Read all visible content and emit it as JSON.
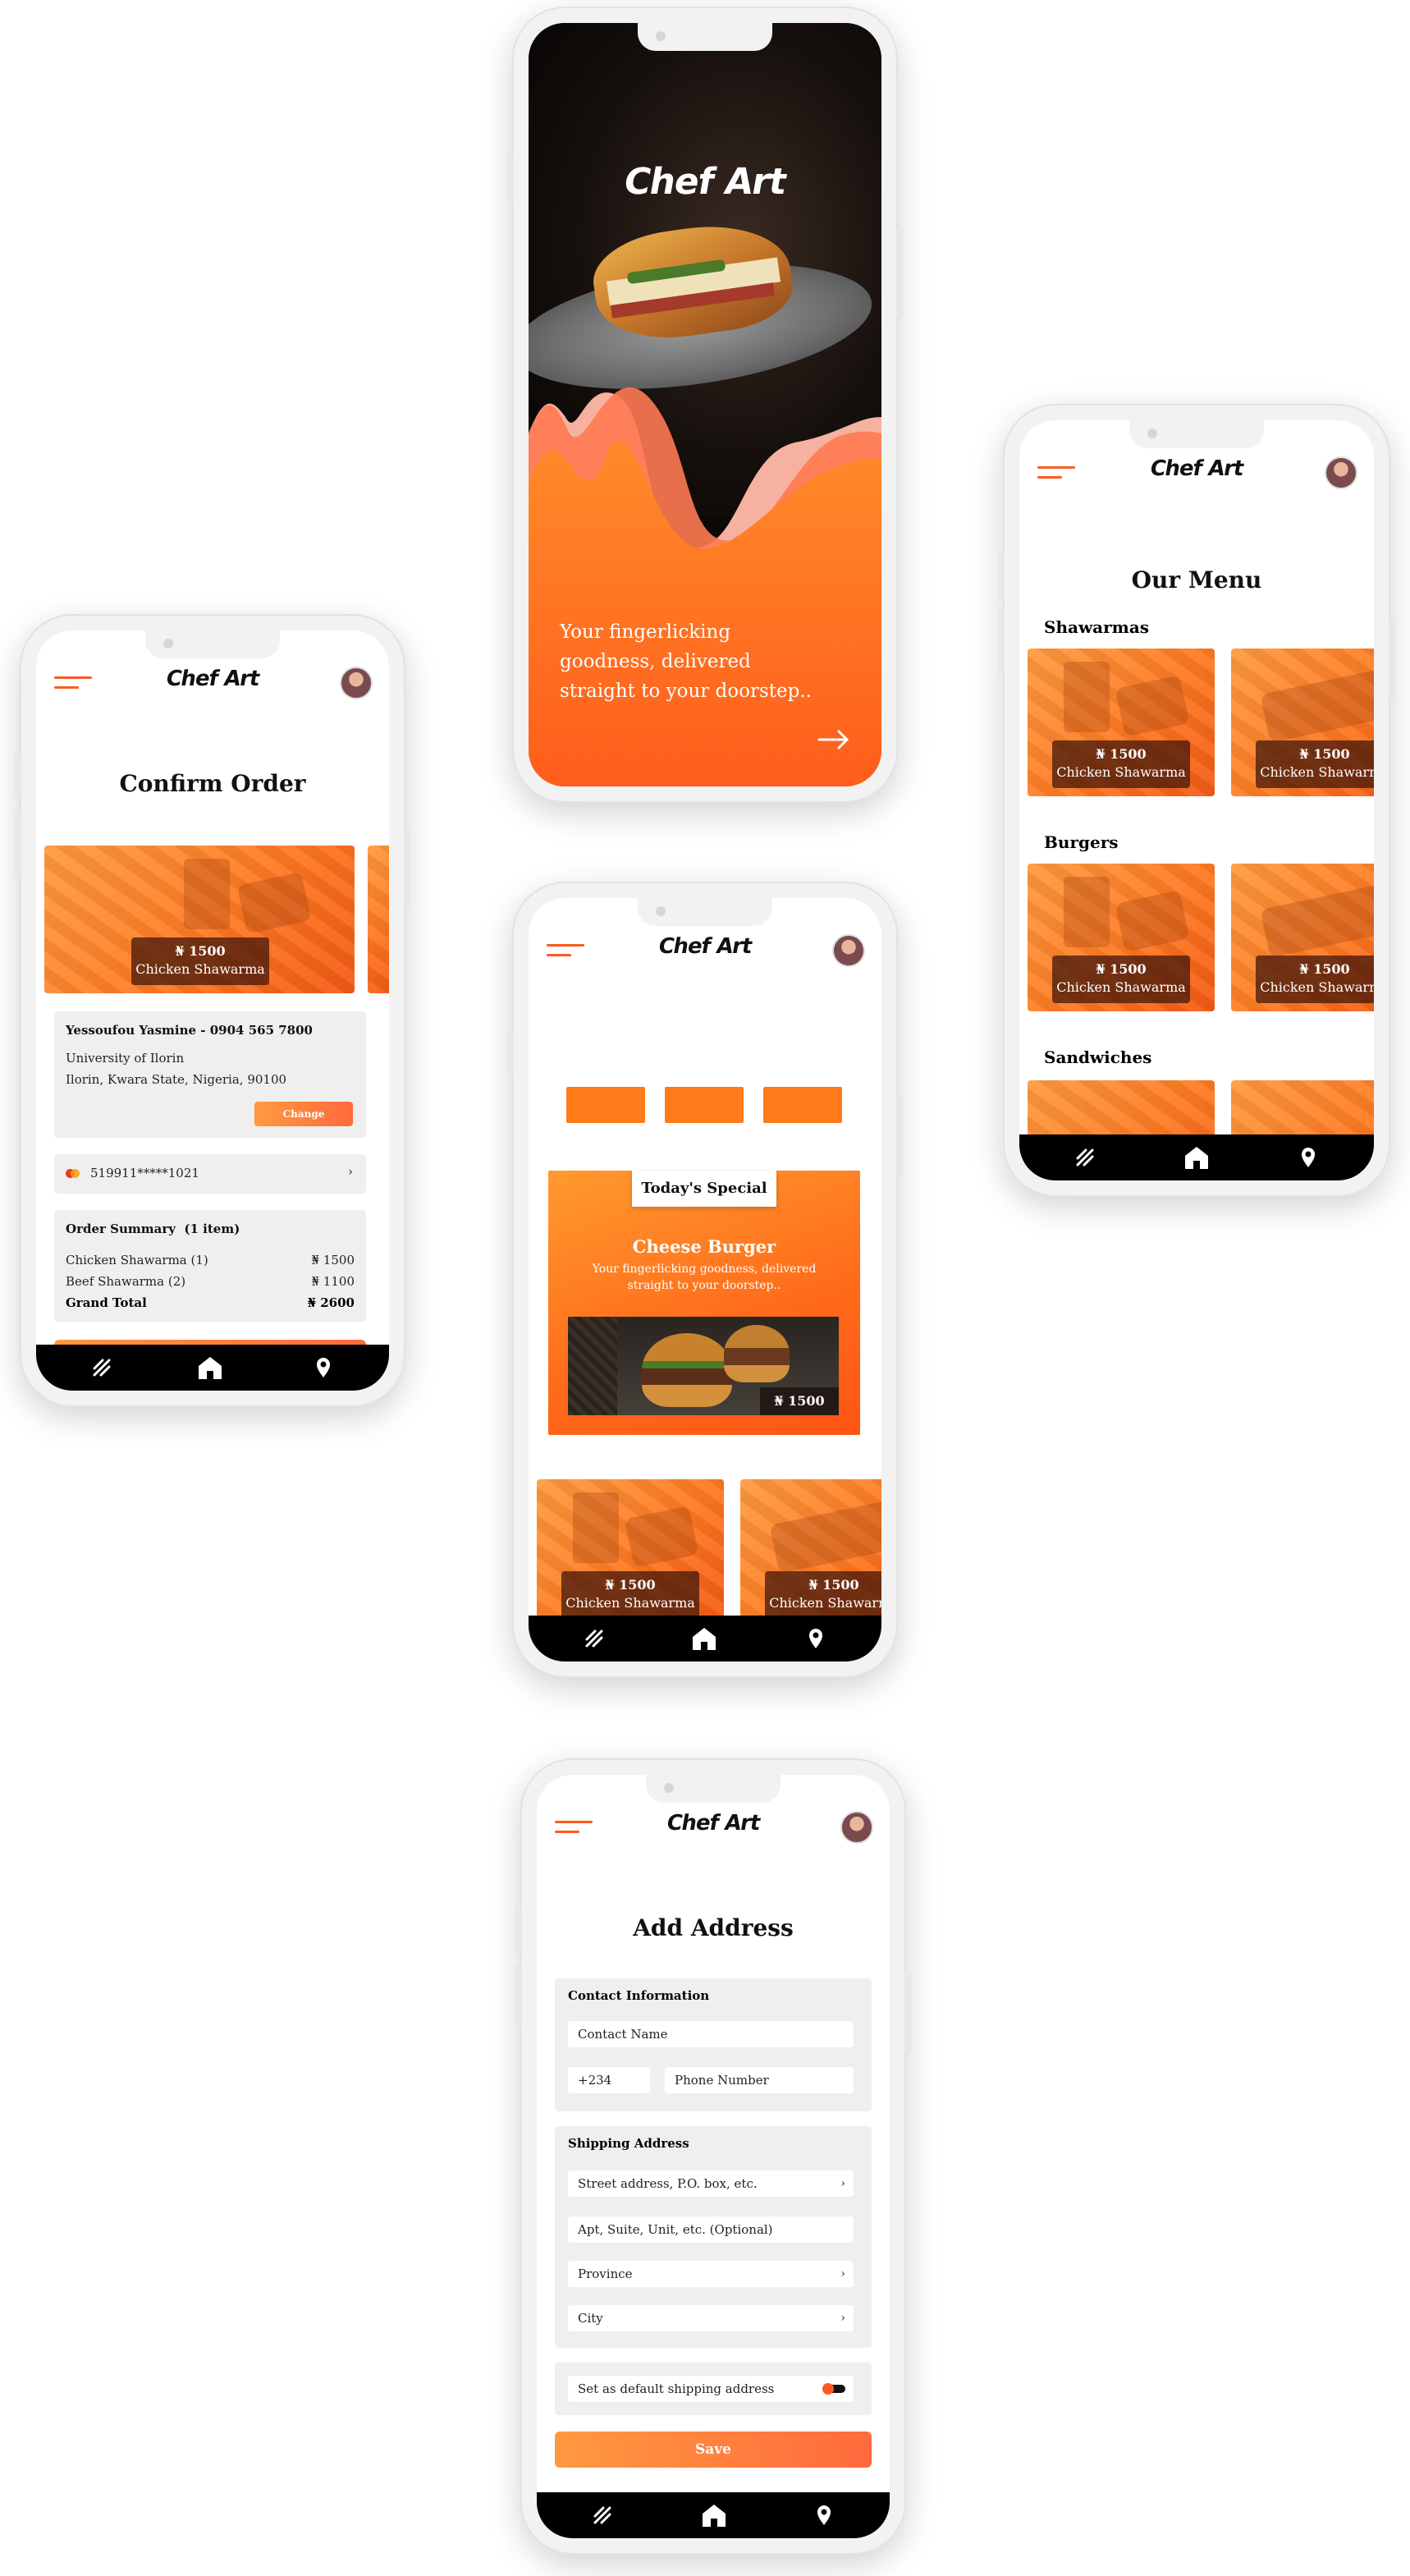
{
  "brand": {
    "logo": "Chef Art",
    "accent": "#ff5a1f"
  },
  "nav": {
    "icons": [
      "menu-stripes-icon",
      "home-icon",
      "location-pin-icon"
    ]
  },
  "splash": {
    "logo": "Chef Art",
    "tagline": "Your fingerlicking goodness, delivered straight to your doorstep..",
    "next_icon": "arrow-right-icon"
  },
  "confirm_order": {
    "title": "Confirm Order",
    "item": {
      "price": "₦ 1500",
      "name": "Chicken Shawarma"
    },
    "contact": {
      "name_phone": "Yessoufou Yasmine - 0904 565 7800",
      "address_line1": "University of Ilorin",
      "address_line2": "Ilorin, Kwara State, Nigeria, 90100",
      "change_label": "Change"
    },
    "card": {
      "number": "519911*****1021",
      "chevron": "›"
    },
    "summary": {
      "header": "Order Summary  (1 item)",
      "lines": [
        {
          "name": "Chicken Shawarma (1)",
          "price": "₦ 1500"
        },
        {
          "name": "Beef Shawarma (2)",
          "price": "₦ 1100"
        }
      ],
      "total_label": "Grand Total",
      "total_value": "₦ 2600"
    }
  },
  "home": {
    "special_tag": "Today's Special",
    "special_title": "Cheese Burger",
    "special_desc": "Your fingerlicking goodness, delivered straight to your doorstep..",
    "special_price": "₦ 1500",
    "cards": [
      {
        "price": "₦ 1500",
        "name": "Chicken Shawarma"
      },
      {
        "price": "₦ 1500",
        "name": "Chicken Shawarma"
      }
    ]
  },
  "menu": {
    "title": "Our Menu",
    "sections": [
      {
        "title": "Shawarmas",
        "cards": [
          {
            "price": "₦ 1500",
            "name": "Chicken Shawarma"
          },
          {
            "price": "₦ 1500",
            "name": "Chicken Shawarma"
          }
        ]
      },
      {
        "title": "Burgers",
        "cards": [
          {
            "price": "₦ 1500",
            "name": "Chicken Shawarma"
          },
          {
            "price": "₦ 1500",
            "name": "Chicken Shawarma"
          }
        ]
      },
      {
        "title": "Sandwiches",
        "cards": []
      }
    ]
  },
  "address": {
    "title": "Add Address",
    "contact_header": "Contact Information",
    "contact_name": "Contact Name",
    "country_code": "+234",
    "phone": "Phone Number",
    "shipping_header": "Shipping Address",
    "street": "Street address, P.O. box, etc.",
    "apt": "Apt, Suite, Unit, etc. (Optional)",
    "province": "Province",
    "city": "City",
    "chevron": "›",
    "default_label": "Set as default shipping address",
    "save_label": "Save"
  }
}
